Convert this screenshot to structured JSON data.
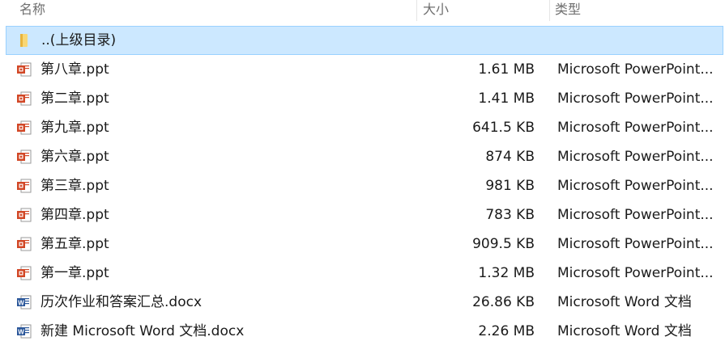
{
  "columns": {
    "name": "名称",
    "size": "大小",
    "type": "类型"
  },
  "parent": {
    "label": "..(上级目录)"
  },
  "files": [
    {
      "name": "第八章.ppt",
      "size": "1.61 MB",
      "type": "Microsoft PowerPoint...",
      "icon": "ppt-file-icon"
    },
    {
      "name": "第二章.ppt",
      "size": "1.41 MB",
      "type": "Microsoft PowerPoint...",
      "icon": "ppt-file-icon"
    },
    {
      "name": "第九章.ppt",
      "size": "641.5 KB",
      "type": "Microsoft PowerPoint...",
      "icon": "ppt-file-icon"
    },
    {
      "name": "第六章.ppt",
      "size": "874 KB",
      "type": "Microsoft PowerPoint...",
      "icon": "ppt-file-icon"
    },
    {
      "name": "第三章.ppt",
      "size": "981 KB",
      "type": "Microsoft PowerPoint...",
      "icon": "ppt-file-icon"
    },
    {
      "name": "第四章.ppt",
      "size": "783 KB",
      "type": "Microsoft PowerPoint...",
      "icon": "ppt-file-icon"
    },
    {
      "name": "第五章.ppt",
      "size": "909.5 KB",
      "type": "Microsoft PowerPoint...",
      "icon": "ppt-file-icon"
    },
    {
      "name": "第一章.ppt",
      "size": "1.32 MB",
      "type": "Microsoft PowerPoint...",
      "icon": "ppt-file-icon"
    },
    {
      "name": "历次作业和答案汇总.docx",
      "size": "26.86 KB",
      "type": "Microsoft Word 文档",
      "icon": "word-file-icon"
    },
    {
      "name": "新建 Microsoft Word 文档.docx",
      "size": "2.26 MB",
      "type": "Microsoft Word 文档",
      "icon": "word-file-icon"
    }
  ],
  "colors": {
    "selection_bg": "#cce8ff",
    "selection_border": "#99d1ff",
    "ppt": "#d24726",
    "word": "#2b579a",
    "folder": "#f8d775"
  }
}
